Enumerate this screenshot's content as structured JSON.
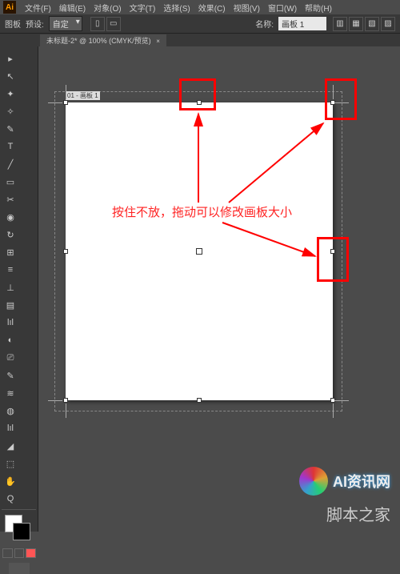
{
  "menubar": {
    "app": "Ai",
    "items": [
      "文件(F)",
      "编辑(E)",
      "对象(O)",
      "文字(T)",
      "选择(S)",
      "效果(C)",
      "视图(V)",
      "窗口(W)",
      "帮助(H)"
    ]
  },
  "controlbar": {
    "mode_label": "图板",
    "preset_label": "预设:",
    "preset_value": "自定",
    "name_label": "名称:",
    "name_value": "画板 1"
  },
  "tab": {
    "title": "未标题-2* @ 100% (CMYK/预览)",
    "close": "×"
  },
  "artboard": {
    "label": "01 - 画板 1"
  },
  "annotation": {
    "text": "按住不放，拖动可以修改画板大小"
  },
  "watermarks": {
    "w1": "AI资讯网",
    "w2": "脚本之家"
  },
  "tools": [
    "▸",
    "↖",
    "✦",
    "✧",
    "✎",
    "T",
    "╱",
    "▭",
    "✂",
    "◉",
    "↻",
    "⊞",
    "≡",
    "⊥",
    "▤",
    "lıl",
    "◐",
    "⎚",
    "✎",
    "≋",
    "◍",
    "lıl",
    "◢",
    "⬚",
    "✋",
    "Q"
  ]
}
